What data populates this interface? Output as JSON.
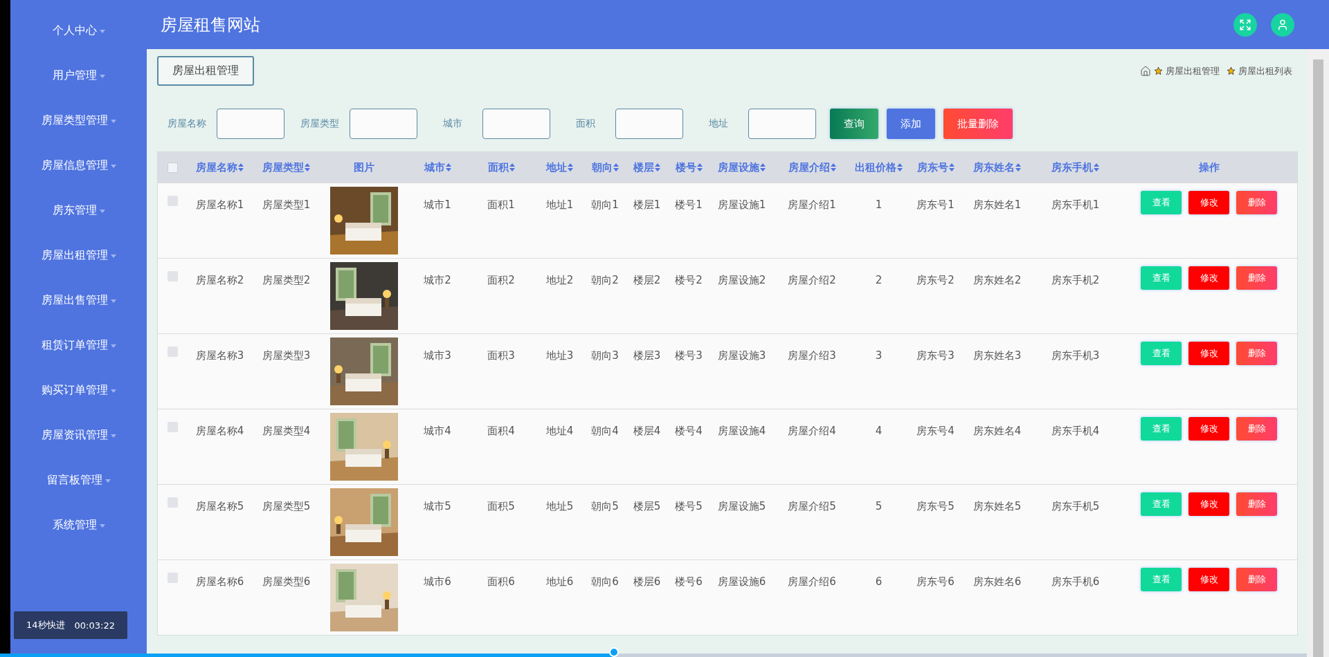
{
  "sidebar": {
    "items": [
      {
        "label": "个人中心"
      },
      {
        "label": "用户管理"
      },
      {
        "label": "房屋类型管理"
      },
      {
        "label": "房屋信息管理"
      },
      {
        "label": "房东管理"
      },
      {
        "label": "房屋出租管理"
      },
      {
        "label": "房屋出售管理"
      },
      {
        "label": "租赁订单管理"
      },
      {
        "label": "购买订单管理"
      },
      {
        "label": "房屋资讯管理"
      },
      {
        "label": "留言板管理"
      },
      {
        "label": "系统管理"
      }
    ]
  },
  "header": {
    "title": "房屋租售网站"
  },
  "page_tab": "房屋出租管理",
  "breadcrumb": [
    "房屋出租管理",
    "房屋出租列表"
  ],
  "search": {
    "fields": [
      {
        "label": "房屋名称"
      },
      {
        "label": "房屋类型"
      },
      {
        "label": "城市"
      },
      {
        "label": "面积"
      },
      {
        "label": "地址"
      }
    ],
    "buttons": [
      {
        "label": "查询",
        "kind": "query"
      },
      {
        "label": "添加",
        "kind": "add"
      },
      {
        "label": "批量删除",
        "kind": "delete"
      }
    ]
  },
  "table": {
    "header_checked": false,
    "columns": [
      {
        "label": "房屋名称",
        "kind": "text",
        "sortable": true
      },
      {
        "label": "房屋类型",
        "kind": "text",
        "sortable": true
      },
      {
        "label": "图片",
        "kind": "picture",
        "sortable": false
      },
      {
        "label": "城市",
        "kind": "text",
        "sortable": true
      },
      {
        "label": "面积",
        "kind": "text",
        "sortable": true
      },
      {
        "label": "地址",
        "kind": "text",
        "sortable": true
      },
      {
        "label": "朝向",
        "kind": "text",
        "sortable": true
      },
      {
        "label": "楼层",
        "kind": "text",
        "sortable": true
      },
      {
        "label": "楼号",
        "kind": "text",
        "sortable": true
      },
      {
        "label": "房屋设施",
        "kind": "text",
        "sortable": true
      },
      {
        "label": "房屋介绍",
        "kind": "text",
        "sortable": true
      },
      {
        "label": "出租价格",
        "kind": "text",
        "sortable": true
      },
      {
        "label": "房东号",
        "kind": "text",
        "sortable": true
      },
      {
        "label": "房东姓名",
        "kind": "text",
        "sortable": true
      },
      {
        "label": "房东手机",
        "kind": "text",
        "sortable": true
      },
      {
        "label": "操作",
        "kind": "actions",
        "sortable": false
      }
    ],
    "rows": [
      {
        "checked": false,
        "cells": [
          "房屋名称1",
          "房屋类型1",
          {
            "kind": "picture"
          },
          "城市1",
          "面积1",
          "地址1",
          "朝向1",
          "楼层1",
          "楼号1",
          "房屋设施1",
          "房屋介绍1",
          "1",
          "房东号1",
          "房东姓名1",
          "房东手机1"
        ],
        "actions": [
          {
            "label": "查看",
            "kind": "view"
          },
          {
            "label": "修改",
            "kind": "edit"
          },
          {
            "label": "删除",
            "kind": "delete"
          }
        ]
      },
      {
        "checked": false,
        "cells": [
          "房屋名称2",
          "房屋类型2",
          {
            "kind": "picture"
          },
          "城市2",
          "面积2",
          "地址2",
          "朝向2",
          "楼层2",
          "楼号2",
          "房屋设施2",
          "房屋介绍2",
          "2",
          "房东号2",
          "房东姓名2",
          "房东手机2"
        ],
        "actions": [
          {
            "label": "查看",
            "kind": "view"
          },
          {
            "label": "修改",
            "kind": "edit"
          },
          {
            "label": "删除",
            "kind": "delete"
          }
        ]
      },
      {
        "checked": false,
        "cells": [
          "房屋名称3",
          "房屋类型3",
          {
            "kind": "picture"
          },
          "城市3",
          "面积3",
          "地址3",
          "朝向3",
          "楼层3",
          "楼号3",
          "房屋设施3",
          "房屋介绍3",
          "3",
          "房东号3",
          "房东姓名3",
          "房东手机3"
        ],
        "actions": [
          {
            "label": "查看",
            "kind": "view"
          },
          {
            "label": "修改",
            "kind": "edit"
          },
          {
            "label": "删除",
            "kind": "delete"
          }
        ]
      },
      {
        "checked": false,
        "cells": [
          "房屋名称4",
          "房屋类型4",
          {
            "kind": "picture"
          },
          "城市4",
          "面积4",
          "地址4",
          "朝向4",
          "楼层4",
          "楼号4",
          "房屋设施4",
          "房屋介绍4",
          "4",
          "房东号4",
          "房东姓名4",
          "房东手机4"
        ],
        "actions": [
          {
            "label": "查看",
            "kind": "view"
          },
          {
            "label": "修改",
            "kind": "edit"
          },
          {
            "label": "删除",
            "kind": "delete"
          }
        ]
      },
      {
        "checked": false,
        "cells": [
          "房屋名称5",
          "房屋类型5",
          {
            "kind": "picture"
          },
          "城市5",
          "面积5",
          "地址5",
          "朝向5",
          "楼层5",
          "楼号5",
          "房屋设施5",
          "房屋介绍5",
          "5",
          "房东号5",
          "房东姓名5",
          "房东手机5"
        ],
        "actions": [
          {
            "label": "查看",
            "kind": "view"
          },
          {
            "label": "修改",
            "kind": "edit"
          },
          {
            "label": "删除",
            "kind": "delete"
          }
        ]
      },
      {
        "checked": false,
        "cells": [
          "房屋名称6",
          "房屋类型6",
          {
            "kind": "picture"
          },
          "城市6",
          "面积6",
          "地址6",
          "朝向6",
          "楼层6",
          "楼号6",
          "房屋设施6",
          "房屋介绍6",
          "6",
          "房东号6",
          "房东姓名6",
          "房东手机6"
        ],
        "actions": [
          {
            "label": "查看",
            "kind": "view"
          },
          {
            "label": "修改",
            "kind": "edit"
          },
          {
            "label": "删除",
            "kind": "delete"
          }
        ]
      }
    ]
  },
  "video_overlay": {
    "label": "14秒快进",
    "time": "00:03:22",
    "level": 0.47
  }
}
